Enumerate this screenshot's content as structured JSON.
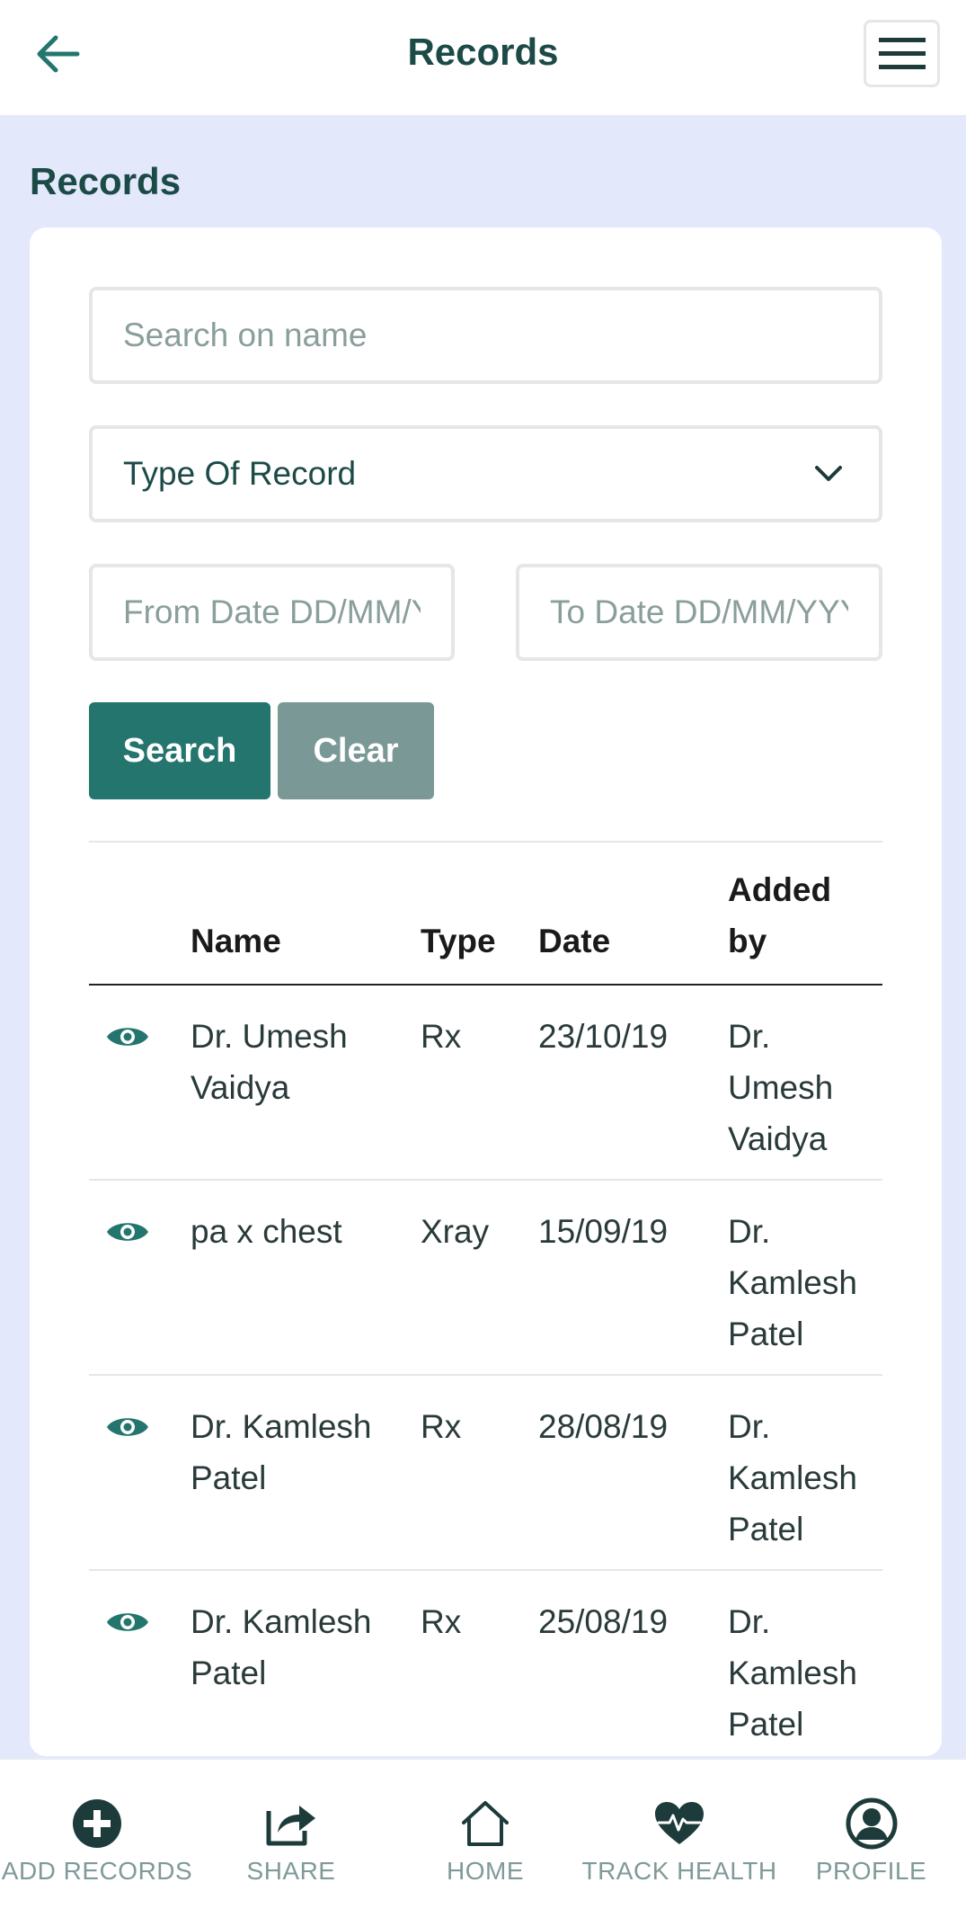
{
  "header": {
    "title": "Records"
  },
  "page": {
    "heading": "Records"
  },
  "filters": {
    "search_placeholder": "Search on name",
    "type_select_value": "Type Of Record",
    "from_date_placeholder": "From Date DD/MM/YYYY",
    "to_date_placeholder": "To Date DD/MM/YYYY",
    "search_button": "Search",
    "clear_button": "Clear"
  },
  "table": {
    "columns": {
      "name": "Name",
      "type": "Type",
      "date": "Date",
      "added_by_line1": "Added",
      "added_by_line2": "by"
    },
    "rows": [
      {
        "name_line1": "Dr. Umesh",
        "name_line2": "Vaidya",
        "type": "Rx",
        "date": "23/10/19",
        "added_line1": "Dr.",
        "added_line2": "Umesh",
        "added_line3": "Vaidya"
      },
      {
        "name_line1": "pa x chest",
        "name_line2": "",
        "type": "Xray",
        "date": "15/09/19",
        "added_line1": "Dr.",
        "added_line2": "Kamlesh",
        "added_line3": "Patel"
      },
      {
        "name_line1": "Dr. Kamlesh",
        "name_line2": "Patel",
        "type": "Rx",
        "date": "28/08/19",
        "added_line1": "Dr.",
        "added_line2": "Kamlesh",
        "added_line3": "Patel"
      },
      {
        "name_line1": "Dr. Kamlesh",
        "name_line2": "Patel",
        "type": "Rx",
        "date": "25/08/19",
        "added_line1": "Dr.",
        "added_line2": "Kamlesh",
        "added_line3": "Patel"
      }
    ]
  },
  "bottom_nav": {
    "items": [
      {
        "label": "ADD RECORDS",
        "icon": "plus-circle-icon"
      },
      {
        "label": "SHARE",
        "icon": "share-icon"
      },
      {
        "label": "HOME",
        "icon": "home-icon"
      },
      {
        "label": "TRACK HEALTH",
        "icon": "heartbeat-icon"
      },
      {
        "label": "PROFILE",
        "icon": "user-circle-icon"
      }
    ]
  },
  "colors": {
    "primary": "#23756d",
    "secondary_button": "#7a9996",
    "page_background": "#e3e8fb",
    "text_dark": "#1c4a47",
    "nav_icon": "#1d3b3a",
    "nav_label": "#7f9a98"
  }
}
